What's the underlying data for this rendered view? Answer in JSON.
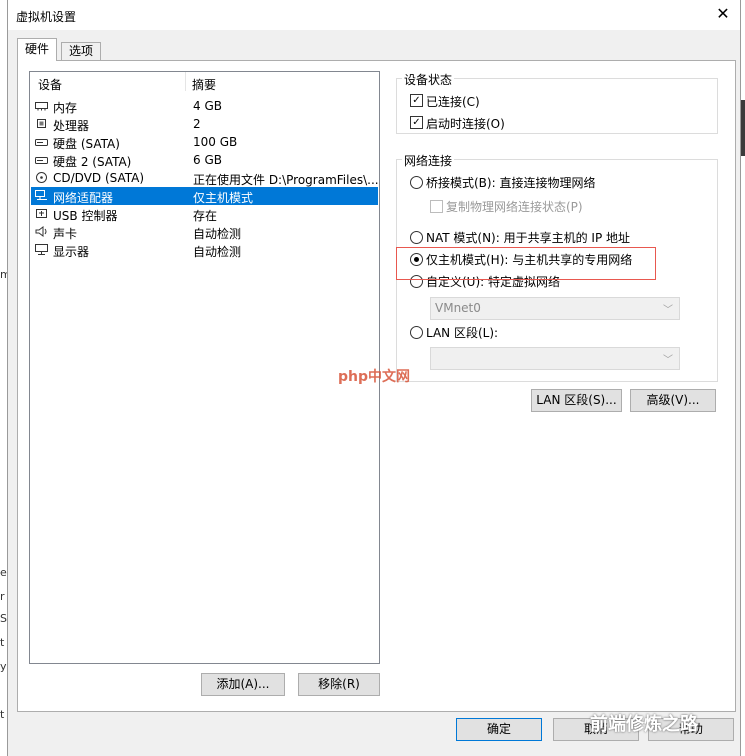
{
  "window": {
    "title": "虚拟机设置",
    "close_glyph": "✕"
  },
  "tabs": [
    {
      "label": "硬件"
    },
    {
      "label": "选项"
    }
  ],
  "device_list": {
    "columns": [
      "设备",
      "摘要"
    ],
    "rows": [
      {
        "icon": "memory-icon",
        "device": "内存",
        "summary": "4 GB"
      },
      {
        "icon": "cpu-icon",
        "device": "处理器",
        "summary": "2"
      },
      {
        "icon": "disk-icon",
        "device": "硬盘 (SATA)",
        "summary": "100 GB"
      },
      {
        "icon": "disk-icon",
        "device": "硬盘 2 (SATA)",
        "summary": "6 GB"
      },
      {
        "icon": "cd-icon",
        "device": "CD/DVD (SATA)",
        "summary": "正在使用文件 D:\\ProgramFiles\\..."
      },
      {
        "icon": "network-adapter-icon",
        "device": "网络适配器",
        "summary": "仅主机模式",
        "selected": true
      },
      {
        "icon": "usb-icon",
        "device": "USB 控制器",
        "summary": "存在"
      },
      {
        "icon": "speaker-icon",
        "device": "声卡",
        "summary": "自动检测"
      },
      {
        "icon": "monitor-icon",
        "device": "显示器",
        "summary": "自动检测"
      }
    ]
  },
  "buttons": {
    "add": "添加(A)...",
    "remove": "移除(R)",
    "lan_segments": "LAN 区段(S)...",
    "advanced": "高级(V)...",
    "ok": "确定",
    "cancel": "取消",
    "help": "帮助"
  },
  "device_status": {
    "title": "设备状态",
    "connected": {
      "label": "已连接(C)",
      "checked": true
    },
    "connect_at_power_on": {
      "label": "启动时连接(O)",
      "checked": true
    }
  },
  "network_connection": {
    "title": "网络连接",
    "bridged": "桥接模式(B): 直接连接物理网络",
    "replicate": "复制物理网络连接状态(P)",
    "nat": "NAT 模式(N): 用于共享主机的 IP 地址",
    "host_only": "仅主机模式(H): 与主机共享的专用网络",
    "custom": "自定义(U): 特定虚拟网络",
    "custom_value": "VMnet0",
    "lan_segment": "LAN 区段(L):",
    "lan_segment_value": "",
    "selected": "host_only"
  },
  "watermarks": {
    "php": "php中文网",
    "wechat": "前端修炼之路"
  },
  "background_fragments": [
    "m",
    "e",
    "r",
    "S",
    "t",
    "y",
    "t"
  ],
  "colors": {
    "selection": "#0078d7",
    "highlight_box": "#e8584f",
    "dialog_bg": "#f0f0f0"
  }
}
